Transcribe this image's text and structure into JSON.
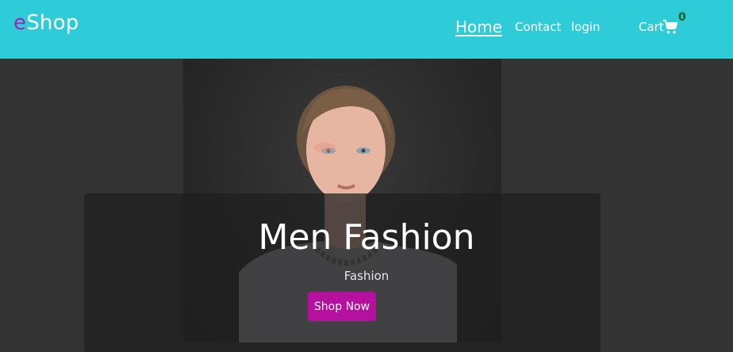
{
  "brand": {
    "first_letter": "e",
    "rest": "Shop"
  },
  "nav": {
    "home": "Home",
    "contact": "Contact",
    "login": "login",
    "cart": "Cart",
    "cart_count": "0"
  },
  "hero": {
    "title": "Men Fashion",
    "subtitle": "Fashion",
    "button": "Shop Now"
  },
  "colors": {
    "navbar": "#2ecbd8",
    "brand_accent": "#9c27b0",
    "button": "#b5109e",
    "cart_count": "#1b5e20"
  },
  "icons": {
    "cart": "shopping-cart-icon"
  }
}
